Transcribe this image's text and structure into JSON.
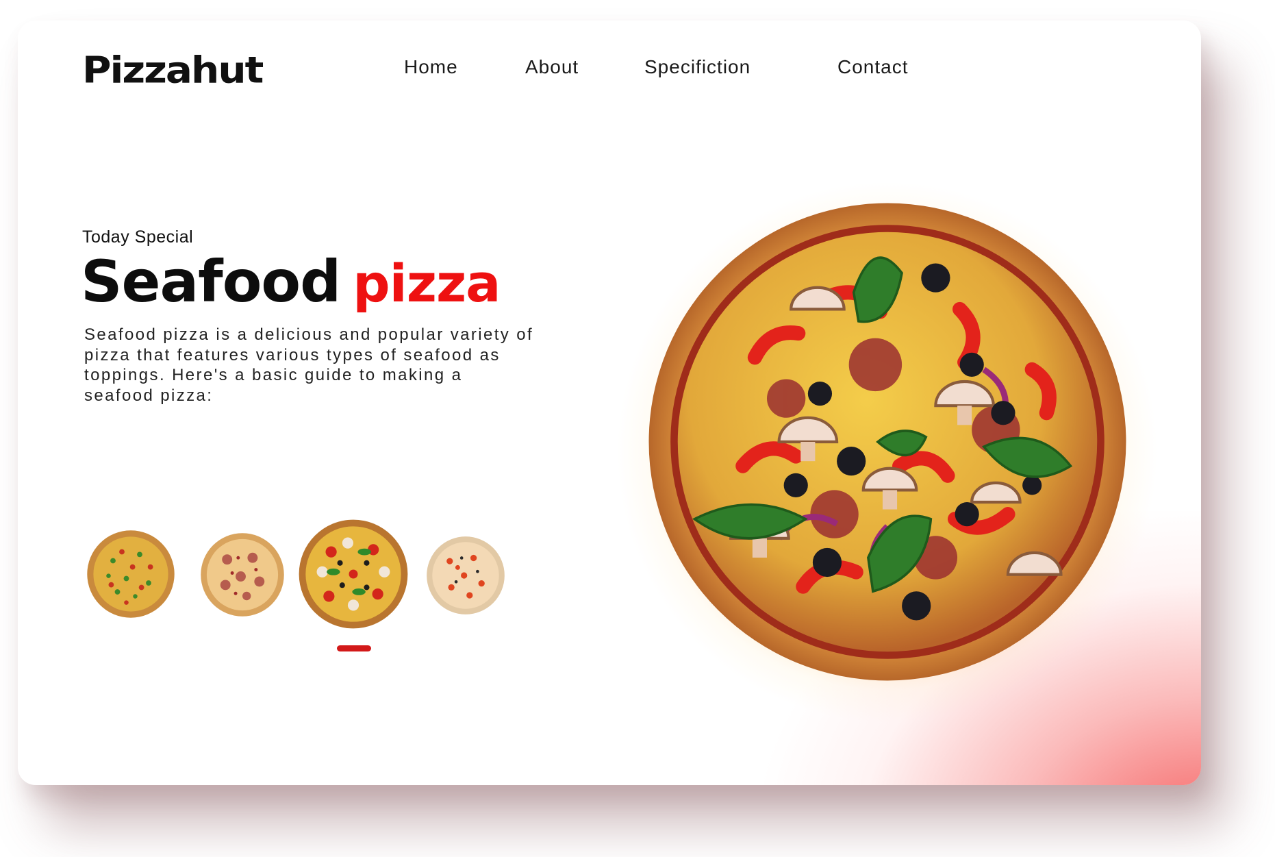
{
  "brand": {
    "logo": "Pizzahut"
  },
  "nav": {
    "items": [
      "Home",
      "About",
      "Specifiction",
      "Contact"
    ]
  },
  "hero": {
    "subtitle": "Today Special",
    "title_word1": "Seafood",
    "title_word2": "pizza",
    "description": "Seafood pizza is a delicious and popular variety of pizza that features various types of seafood as toppings. Here's a basic guide to making a seafood pizza:"
  },
  "carousel": {
    "count": 4,
    "active_index": 2
  },
  "colors": {
    "accent": "#ee1111",
    "text": "#111111",
    "glow": "#f55a5a"
  },
  "icons": [
    "pizza-image"
  ]
}
